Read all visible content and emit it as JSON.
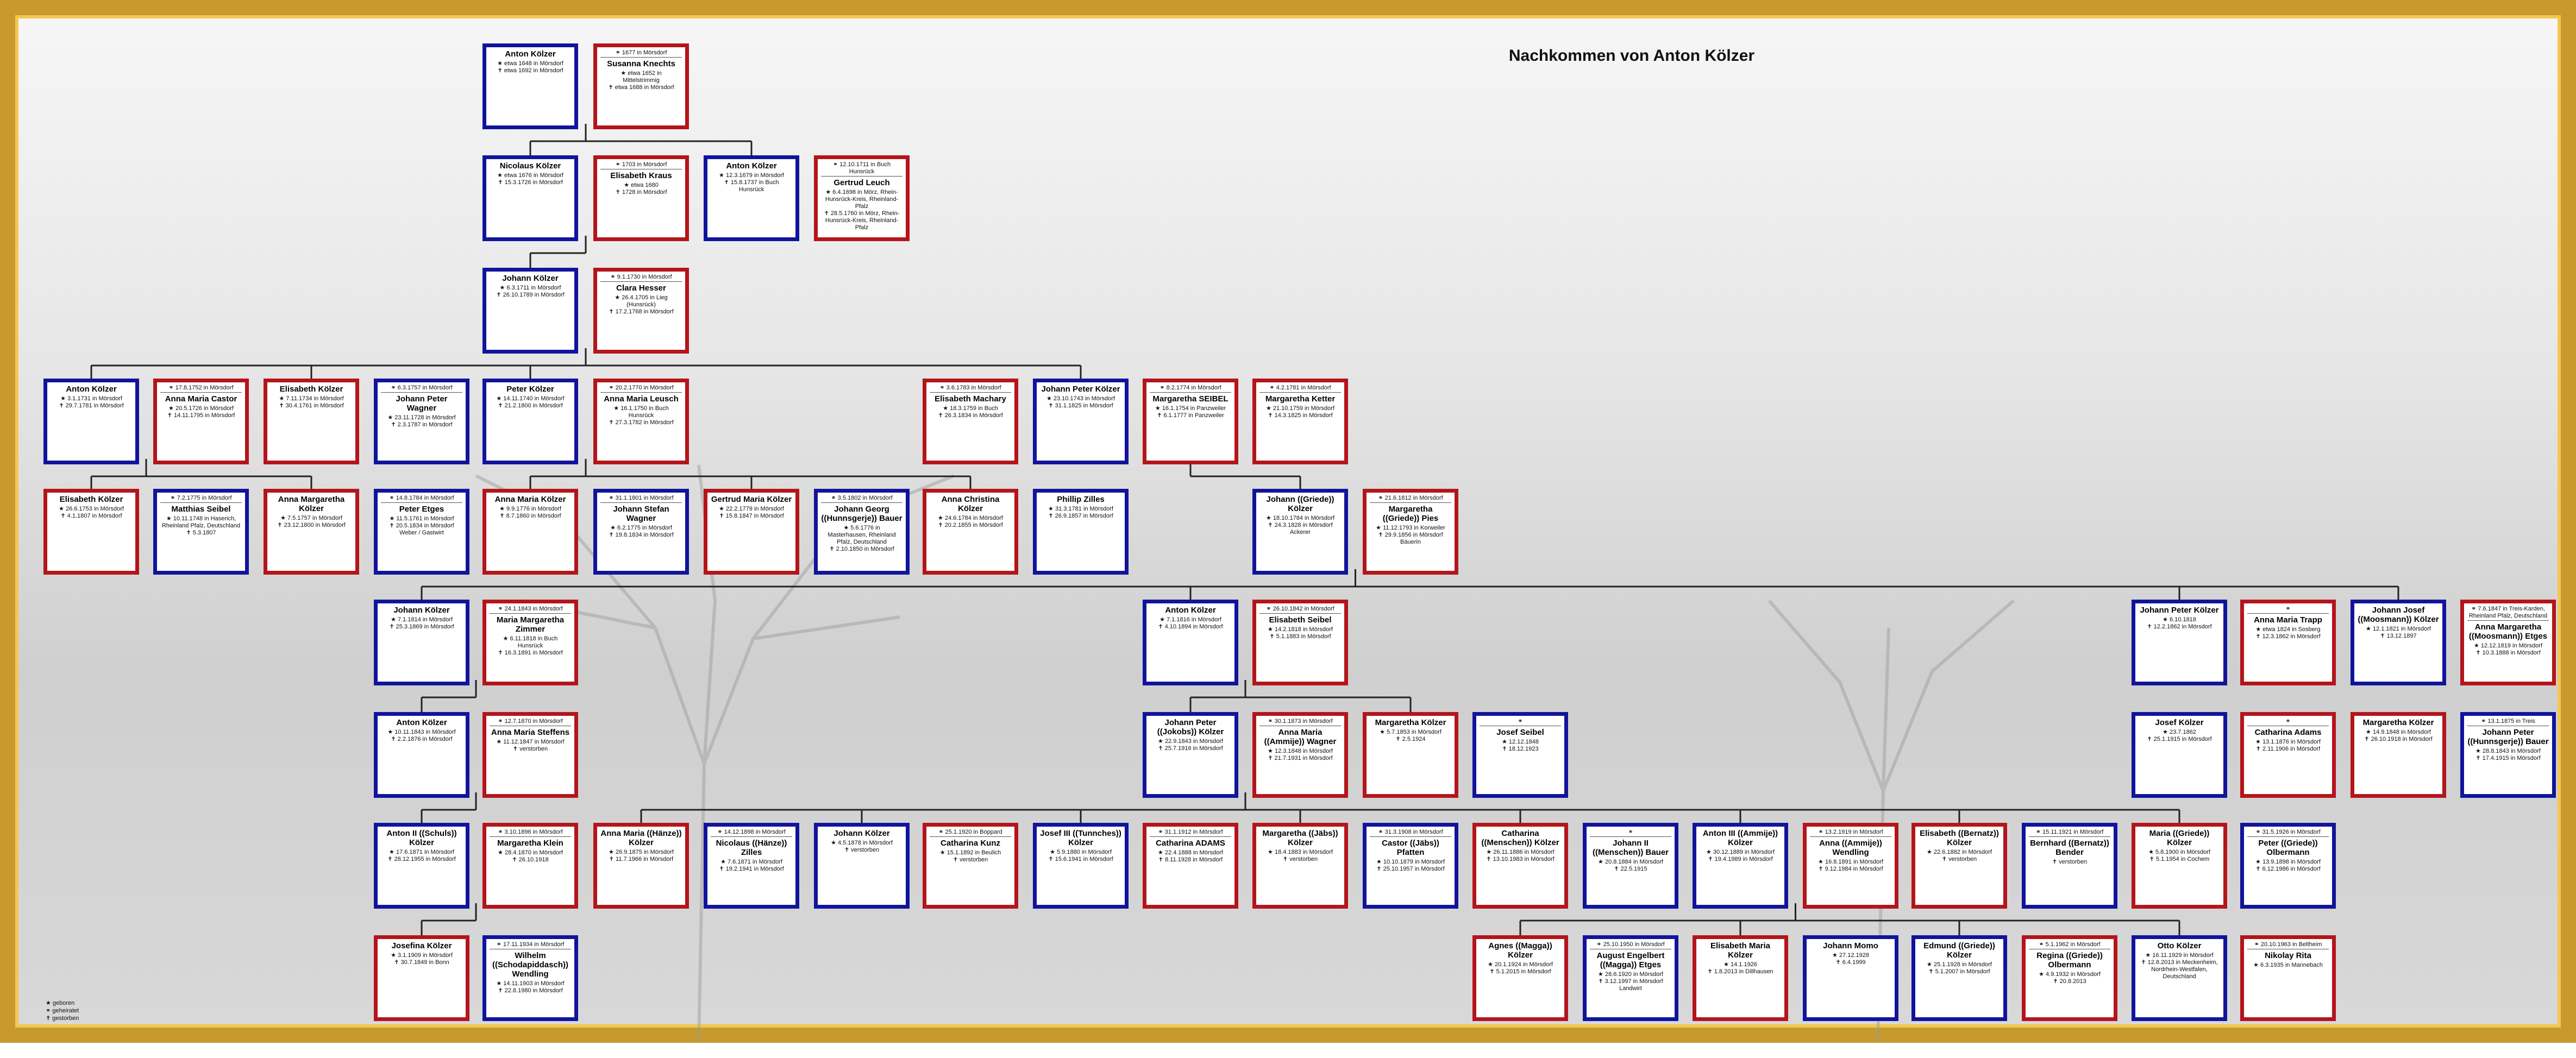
{
  "title": "Nachkommen von Anton Kölzer",
  "legend": [
    "★ geboren",
    "⚭ geheiratet",
    "✝ gestorben"
  ],
  "persons": [
    {
      "id": "p1",
      "sex": "m",
      "name": "Anton Kölzer",
      "ev": [
        "★ etwa 1648 in Mörsdorf",
        "✝ etwa 1692 in Mörsdorf"
      ]
    },
    {
      "id": "p2",
      "sex": "f",
      "mar": "⚭ 1677 in Mörsdorf",
      "name": "Susanna Knechts",
      "ev": [
        "★ etwa 1652 in",
        "Mittelstrimmig",
        "✝ etwa 1688 in Mörsdorf"
      ]
    },
    {
      "id": "p3",
      "sex": "m",
      "name": "Nicolaus Kölzer",
      "ev": [
        "★ etwa 1676 in Mörsdorf",
        "✝ 15.3.1726 in Mörsdorf"
      ]
    },
    {
      "id": "p4",
      "sex": "f",
      "mar": "⚭ 1703 in Mörsdorf",
      "name": "Elisabeth Kraus",
      "ev": [
        "★ etwa 1680",
        "✝ 1728 in Mörsdorf"
      ]
    },
    {
      "id": "p5",
      "sex": "m",
      "name": "Anton Kölzer",
      "ev": [
        "★ 12.3.1679 in Mörsdorf",
        "✝ 15.8.1737 in Buch",
        "Hunsrück"
      ]
    },
    {
      "id": "p6",
      "sex": "f",
      "mar": "⚭ 12.10.1711 in Buch Hunsrück",
      "name": "Gertrud Leuch",
      "ev": [
        "★ 6.4.1698 in Mörz, Rhein-",
        "Hunsrück-Kreis, Rheinland-",
        "Pfalz",
        "✝ 28.5.1760 in Mörz, Rhein-",
        "Hunsrück-Kreis, Rheinland-",
        "Pfalz"
      ]
    },
    {
      "id": "p7",
      "sex": "m",
      "name": "Johann Kölzer",
      "ev": [
        "★ 6.3.1711 in Mörsdorf",
        "✝ 26.10.1789 in Mörsdorf"
      ]
    },
    {
      "id": "p8",
      "sex": "f",
      "mar": "⚭ 9.1.1730 in Mörsdorf",
      "name": "Clara Hesser",
      "ev": [
        "★ 26.4.1705 in Lieg",
        "(Hunsrück)",
        "✝ 17.2.1768 in Mörsdorf"
      ]
    },
    {
      "id": "p9",
      "sex": "m",
      "name": "Anton Kölzer",
      "ev": [
        "★ 3.1.1731 in Mörsdorf",
        "✝ 29.7.1781 in Mörsdorf"
      ]
    },
    {
      "id": "p10",
      "sex": "f",
      "mar": "⚭ 17.8.1752 in Mörsdorf",
      "name": "Anna Maria Castor",
      "ev": [
        "★ 20.5.1726 in Mörsdorf",
        "✝ 14.11.1795 in Mörsdorf"
      ]
    },
    {
      "id": "p11",
      "sex": "f",
      "name": "Elisabeth Kölzer",
      "ev": [
        "★ 7.11.1734 in Mörsdorf",
        "✝ 30.4.1761 in Mörsdorf"
      ]
    },
    {
      "id": "p12",
      "sex": "m",
      "mar": "⚭ 6.3.1757 in Mörsdorf",
      "name": "Johann Peter Wagner",
      "ev": [
        "★ 23.11.1728 in Mörsdorf",
        "✝ 2.3.1787 in Mörsdorf"
      ]
    },
    {
      "id": "p13",
      "sex": "m",
      "name": "Peter Kölzer",
      "ev": [
        "★ 14.11.1740 in Mörsdorf",
        "✝ 21.2.1800 in Mörsdorf"
      ]
    },
    {
      "id": "p14",
      "sex": "f",
      "mar": "⚭ 20.2.1770 in Mörsdorf",
      "name": "Anna Maria Leusch",
      "ev": [
        "★ 16.1.1750 in Buch",
        "Hunsrück",
        "✝ 27.3.1782 in Mörsdorf"
      ]
    },
    {
      "id": "p15",
      "sex": "f",
      "mar": "⚭ 3.6.1783 in Mörsdorf",
      "name": "Elisabeth Machary",
      "ev": [
        "★ 18.3.1759 in Buch",
        "✝ 26.3.1834 in Mörsdorf"
      ]
    },
    {
      "id": "p16",
      "sex": "m",
      "name": "Johann Peter Kölzer",
      "ev": [
        "★ 23.10.1743 in Mörsdorf",
        "✝ 31.1.1825 in Mörsdorf"
      ]
    },
    {
      "id": "p17",
      "sex": "f",
      "mar": "⚭ 8.2.1774 in Mörsdorf",
      "name": "Margaretha SEIBEL",
      "ev": [
        "★ 16.1.1754 in Panzweiler",
        "✝ 6.1.1777 in Panzweiler"
      ]
    },
    {
      "id": "p18",
      "sex": "f",
      "mar": "⚭ 4.2.1781 in Mörsdorf",
      "name": "Margaretha Ketter",
      "ev": [
        "★ 21.10.1759 in Mörsdorf",
        "✝ 14.3.1825 in Mörsdorf"
      ]
    },
    {
      "id": "p19",
      "sex": "f",
      "name": "Elisabeth Kölzer",
      "ev": [
        "★ 26.6.1753 in Mörsdorf",
        "✝ 4.1.1807 in Mörsdorf"
      ]
    },
    {
      "id": "p20",
      "sex": "m",
      "mar": "⚭ 7.2.1775 in Mörsdorf",
      "name": "Matthias Seibel",
      "ev": [
        "★ 10.11.1748 in Haserich,",
        "Rheinland Pfalz, Deutschland",
        "✝ 5.3.1807"
      ]
    },
    {
      "id": "p21",
      "sex": "f",
      "name": "Anna Margaretha Kölzer",
      "ev": [
        "★ 7.5.1757 in Mörsdorf",
        "✝ 23.12.1800 in Mörsdorf"
      ]
    },
    {
      "id": "p22",
      "sex": "m",
      "mar": "⚭ 14.8.1784 in Mörsdorf",
      "name": "Peter Etges",
      "ev": [
        "★ 11.5.1761 in Mörsdorf",
        "✝ 20.5.1834 in Mörsdorf",
        "Weber / Gastwirt"
      ]
    },
    {
      "id": "p23",
      "sex": "f",
      "name": "Anna Maria Kölzer",
      "ev": [
        "★ 9.9.1776 in Mörsdorf",
        "✝ 8.7.1860 in Mörsdorf"
      ]
    },
    {
      "id": "p24",
      "sex": "m",
      "mar": "⚭ 31.1.1801 in Mörsdorf",
      "name": "Johann Stefan Wagner",
      "ev": [
        "★ 6.2.1775 in Mörsdorf",
        "✝ 19.8.1834 in Mörsdorf"
      ]
    },
    {
      "id": "p25",
      "sex": "f",
      "name": "Gertrud Maria Kölzer",
      "ev": [
        "★ 22.2.1779 in Mörsdorf",
        "✝ 15.8.1847 in Mörsdorf"
      ]
    },
    {
      "id": "p26",
      "sex": "m",
      "mar": "⚭ 3.5.1802 in Mörsdorf",
      "name": "Johann Georg ((Hunnsgerje)) Bauer",
      "ev": [
        "★ 5.6.1776 in",
        "Masterhausen, Rheinland",
        "Pfalz, Deutschland",
        "✝ 2.10.1850 in Mörsdorf"
      ]
    },
    {
      "id": "p27",
      "sex": "f",
      "name": "Anna Christina Kölzer",
      "ev": [
        "★ 24.6.1784 in Mörsdorf",
        "✝ 20.2.1855 in Mörsdorf"
      ]
    },
    {
      "id": "p28",
      "sex": "m",
      "name": "Phillip Zilles",
      "ev": [
        "★ 31.3.1781 in Mörsdorf",
        "✝ 26.9.1857 in Mörsdorf"
      ]
    },
    {
      "id": "p29",
      "sex": "m",
      "name": "Johann ((Griede)) Kölzer",
      "ev": [
        "★ 18.10.1784 in Mörsdorf",
        "✝ 24.3.1828 in Mörsdorf",
        "Ackerer"
      ]
    },
    {
      "id": "p30",
      "sex": "f",
      "mar": "⚭ 21.6.1812 in Mörsdorf",
      "name": "Margaretha ((Griede)) Pies",
      "ev": [
        "★ 11.12.1793 in Korweiler",
        "✝ 29.9.1856 in Mörsdorf",
        "Bäuerin"
      ]
    },
    {
      "id": "p31",
      "sex": "m",
      "name": "Johann Kölzer",
      "ev": [
        "★ 7.1.1814 in Mörsdorf",
        "✝ 25.3.1869 in Mörsdorf"
      ]
    },
    {
      "id": "p32",
      "sex": "f",
      "mar": "⚭ 24.1.1843 in Mörsdorf",
      "name": "Maria Margaretha Zimmer",
      "ev": [
        "★ 6.11.1818 in Buch",
        "Hunsrück",
        "✝ 16.3.1891 in Mörsdorf"
      ]
    },
    {
      "id": "p33",
      "sex": "m",
      "name": "Anton Kölzer",
      "ev": [
        "★ 7.1.1816 in Mörsdorf",
        "✝ 4.10.1894 in Mörsdorf"
      ]
    },
    {
      "id": "p34",
      "sex": "f",
      "mar": "⚭ 26.10.1842 in Mörsdorf",
      "name": "Elisabeth Seibel",
      "ev": [
        "★ 14.2.1818 in Mörsdorf",
        "✝ 5.1.1883 in Mörsdorf"
      ]
    },
    {
      "id": "p35",
      "sex": "m",
      "name": "Johann Peter Kölzer",
      "ev": [
        "★ 6.10.1818",
        "✝ 12.2.1862 in Mörsdorf"
      ]
    },
    {
      "id": "p36",
      "sex": "f",
      "mar": "⚭",
      "name": "Anna Maria Trapp",
      "ev": [
        "★ etwa 1824 in Sosberg",
        "✝ 12.3.1862 in Mörsdorf"
      ]
    },
    {
      "id": "p37",
      "sex": "m",
      "name": "Johann Josef ((Moosmann)) Kölzer",
      "ev": [
        "★ 12.1.1821 in Mörsdorf",
        "✝ 13.12.1897"
      ]
    },
    {
      "id": "p38",
      "sex": "f",
      "mar": "⚭ 7.6.1847 in Treis-Karden, Rheinland Pfalz, Deutschland",
      "name": "Anna Margaretha ((Moosmann)) Etges",
      "ev": [
        "★ 12.12.1819 in Mörsdorf",
        "✝ 10.3.1888 in Mörsdorf"
      ]
    },
    {
      "id": "p39",
      "sex": "m",
      "name": "Anton Kölzer",
      "ev": [
        "★ 10.11.1843 in Mörsdorf",
        "✝ 2.2.1876 in Mörsdorf"
      ]
    },
    {
      "id": "p40",
      "sex": "f",
      "mar": "⚭ 12.7.1870 in Mörsdorf",
      "name": "Anna Maria Steffens",
      "ev": [
        "★ 11.12.1847 in Mörsdorf",
        "✝ verstorben"
      ]
    },
    {
      "id": "p41",
      "sex": "m",
      "name": "Johann Peter ((Jokobs)) Kölzer",
      "ev": [
        "★ 22.9.1843 in Mörsdorf",
        "✝ 25.7.1916 in Mörsdorf"
      ]
    },
    {
      "id": "p42",
      "sex": "f",
      "mar": "⚭ 30.1.1873 in Mörsdorf",
      "name": "Anna Maria ((Ammije)) Wagner",
      "ev": [
        "★ 12.3.1848 in Mörsdorf",
        "✝ 21.7.1931 in Mörsdorf"
      ]
    },
    {
      "id": "p43",
      "sex": "f",
      "name": "Margaretha Kölzer",
      "ev": [
        "★ 5.7.1853 in Mörsdorf",
        "✝ 2.5.1924"
      ]
    },
    {
      "id": "p44",
      "sex": "m",
      "mar": "⚭",
      "name": "Josef Seibel",
      "ev": [
        "★ 12.12.1848",
        "✝ 18.12.1923"
      ]
    },
    {
      "id": "p45",
      "sex": "m",
      "name": "Josef Kölzer",
      "ev": [
        "★ 23.7.1862",
        "✝ 25.1.1915 in Mörsdorf"
      ]
    },
    {
      "id": "p46",
      "sex": "f",
      "mar": "⚭",
      "name": "Catharina Adams",
      "ev": [
        "★ 13.1.1876 in Mörsdorf",
        "✝ 2.11.1906 in Mörsdorf"
      ]
    },
    {
      "id": "p47",
      "sex": "f",
      "name": "Margaretha Kölzer",
      "ev": [
        "★ 14.9.1848 in Mörsdorf",
        "✝ 26.10.1918 in Mörsdorf"
      ]
    },
    {
      "id": "p48",
      "sex": "m",
      "mar": "⚭ 13.1.1875 in Treis",
      "name": "Johann Peter ((Hunnsgerje)) Bauer",
      "ev": [
        "★ 28.8.1843 in Mörsdorf",
        "✝ 17.4.1915 in Mörsdorf"
      ]
    },
    {
      "id": "p49",
      "sex": "m",
      "name": "Anton II ((Schuls)) Kölzer",
      "ev": [
        "★ 17.6.1871 in Mörsdorf",
        "✝ 28.12.1955 in Mörsdorf"
      ]
    },
    {
      "id": "p50",
      "sex": "f",
      "mar": "⚭ 3.10.1896 in Mörsdorf",
      "name": "Margaretha Klein",
      "ev": [
        "★ 28.4.1870 in Mörsdorf",
        "✝ 26.10.1918"
      ]
    },
    {
      "id": "p51",
      "sex": "f",
      "name": "Anna Maria ((Hänze)) Kölzer",
      "ev": [
        "★ 26.9.1875 in Mörsdorf",
        "✝ 11.7.1966 in Mörsdorf"
      ]
    },
    {
      "id": "p52",
      "sex": "m",
      "mar": "⚭ 14.12.1898 in Mörsdorf",
      "name": "Nicolaus ((Hänze)) Zilles",
      "ev": [
        "★ 7.6.1871 in Mörsdorf",
        "✝ 19.2.1941 in Mörsdorf"
      ]
    },
    {
      "id": "p53",
      "sex": "m",
      "name": "Johann Kölzer",
      "ev": [
        "★ 4.5.1878 in Mörsdorf",
        "✝ verstorben"
      ]
    },
    {
      "id": "p54",
      "sex": "f",
      "mar": "⚭ 25.1.1920 in Boppard",
      "name": "Catharina Kunz",
      "ev": [
        "★ 15.1.1892 in Beulich",
        "✝ verstorben"
      ]
    },
    {
      "id": "p55",
      "sex": "m",
      "name": "Josef III ((Tunnches)) Kölzer",
      "ev": [
        "★ 5.9.1880 in Mörsdorf",
        "✝ 15.6.1941 in Mörsdorf"
      ]
    },
    {
      "id": "p56",
      "sex": "f",
      "mar": "⚭ 31.1.1912 in Mörsdorf",
      "name": "Catharina ADAMS",
      "ev": [
        "★ 22.4.1888 in Mörsdorf",
        "✝ 8.11.1928 in Mörsdorf"
      ]
    },
    {
      "id": "p57",
      "sex": "f",
      "name": "Margaretha ((Jäbs)) Kölzer",
      "ev": [
        "★ 18.4.1883 in Mörsdorf",
        "✝ verstorben"
      ]
    },
    {
      "id": "p58",
      "sex": "m",
      "mar": "⚭ 31.3.1908 in Mörsdorf",
      "name": "Castor ((Jäbs)) Pfatten",
      "ev": [
        "★ 10.10.1879 in Mörsdorf",
        "✝ 25.10.1957 in Mörsdorf"
      ]
    },
    {
      "id": "p59",
      "sex": "f",
      "name": "Catharina ((Menschen)) Kölzer",
      "ev": [
        "★ 26.11.1886 in Mörsdorf",
        "✝ 13.10.1983 in Mörsdorf"
      ]
    },
    {
      "id": "p60",
      "sex": "m",
      "mar": "⚭",
      "name": "Johann II ((Menschen)) Bauer",
      "ev": [
        "★ 20.8.1884 in Mörsdorf",
        "✝ 22.5.1915"
      ]
    },
    {
      "id": "p61",
      "sex": "m",
      "name": "Anton III ((Ammije)) Kölzer",
      "ev": [
        "★ 30.12.1889 in Mörsdorf",
        "✝ 19.4.1989 in Mörsdorf"
      ]
    },
    {
      "id": "p62",
      "sex": "f",
      "mar": "⚭ 13.2.1919 in Mörsdorf",
      "name": "Anna ((Ammije)) Wendling",
      "ev": [
        "★ 16.8.1891 in Mörsdorf",
        "✝ 9.12.1984 in Mörsdorf"
      ]
    },
    {
      "id": "p63",
      "sex": "f",
      "name": "Elisabeth ((Bernatz)) Kölzer",
      "ev": [
        "★ 22.6.1882 in Mörsdorf",
        "✝ verstorben"
      ]
    },
    {
      "id": "p64",
      "sex": "m",
      "mar": "⚭ 15.11.1921 in Mörsdorf",
      "name": "Bernhard ((Bernatz)) Bender",
      "ev": [
        "✝ verstorben"
      ]
    },
    {
      "id": "p65",
      "sex": "f",
      "name": "Maria ((Griede)) Kölzer",
      "ev": [
        "★ 5.8.1900 in Mörsdorf",
        "✝ 5.1.1954 in Cochem"
      ]
    },
    {
      "id": "p66",
      "sex": "m",
      "mar": "⚭ 31.5.1926 in Mörsdorf",
      "name": "Peter ((Griede)) Olbermann",
      "ev": [
        "★ 13.9.1898 in Mörsdorf",
        "✝ 6.12.1986 in Mörsdorf"
      ]
    },
    {
      "id": "p67",
      "sex": "f",
      "name": "Josefina Kölzer",
      "ev": [
        "★ 3.1.1909 in Mörsdorf",
        "✝ 30.7.1849 in Bonn"
      ]
    },
    {
      "id": "p68",
      "sex": "m",
      "mar": "⚭ 17.11.1934 in Mörsdorf",
      "name": "Wilhelm ((Schodapiddasch)) Wendling",
      "ev": [
        "★ 14.11.1903 in Mörsdorf",
        "✝ 22.8.1980 in Mörsdorf"
      ]
    },
    {
      "id": "p69",
      "sex": "f",
      "name": "Agnes ((Magga)) Kölzer",
      "ev": [
        "★ 20.1.1924 in Mörsdorf",
        "✝ 5.1.2015 in Mörsdorf"
      ]
    },
    {
      "id": "p70",
      "sex": "m",
      "mar": "⚭ 25.10.1950 in Mörsdorf",
      "name": "August Engelbert ((Magga)) Etges",
      "ev": [
        "★ 28.6.1920 in Mörsdorf",
        "✝ 3.12.1997 in Mörsdorf",
        "Landwirt"
      ]
    },
    {
      "id": "p71",
      "sex": "f",
      "name": "Elisabeth Maria Kölzer",
      "ev": [
        "★ 14.1.1926",
        "✝ 1.8.2013 in Dillhausen"
      ]
    },
    {
      "id": "p72",
      "sex": "m",
      "name": "Johann Momo",
      "ev": [
        "★ 27.12.1928",
        "✝ 6.4.1999"
      ]
    },
    {
      "id": "p73",
      "sex": "m",
      "name": "Edmund ((Griede)) Kölzer",
      "ev": [
        "★ 25.1.1928 in Mörsdorf",
        "✝ 5.1.2007 in Mörsdorf"
      ]
    },
    {
      "id": "p74",
      "sex": "f",
      "mar": "⚭ 5.1.1962 in Mörsdorf",
      "name": "Regina ((Griede)) Olbermann",
      "ev": [
        "★ 4.9.1932 in Mörsdorf",
        "✝ 20.8.2013"
      ]
    },
    {
      "id": "p75",
      "sex": "m",
      "name": "Otto Kölzer",
      "ev": [
        "★ 16.11.1929 in Mörsdorf",
        "✝ 12.8.2013 in Meckenheim,",
        "Nordrhein-Westfalen,",
        "Deutschland"
      ]
    },
    {
      "id": "p76",
      "sex": "f",
      "mar": "⚭ 20.10.1963 in Beltheim",
      "name": "Nikolay Rita",
      "ev": [
        "★ 6.3.1935 in Mannebach"
      ]
    }
  ]
}
